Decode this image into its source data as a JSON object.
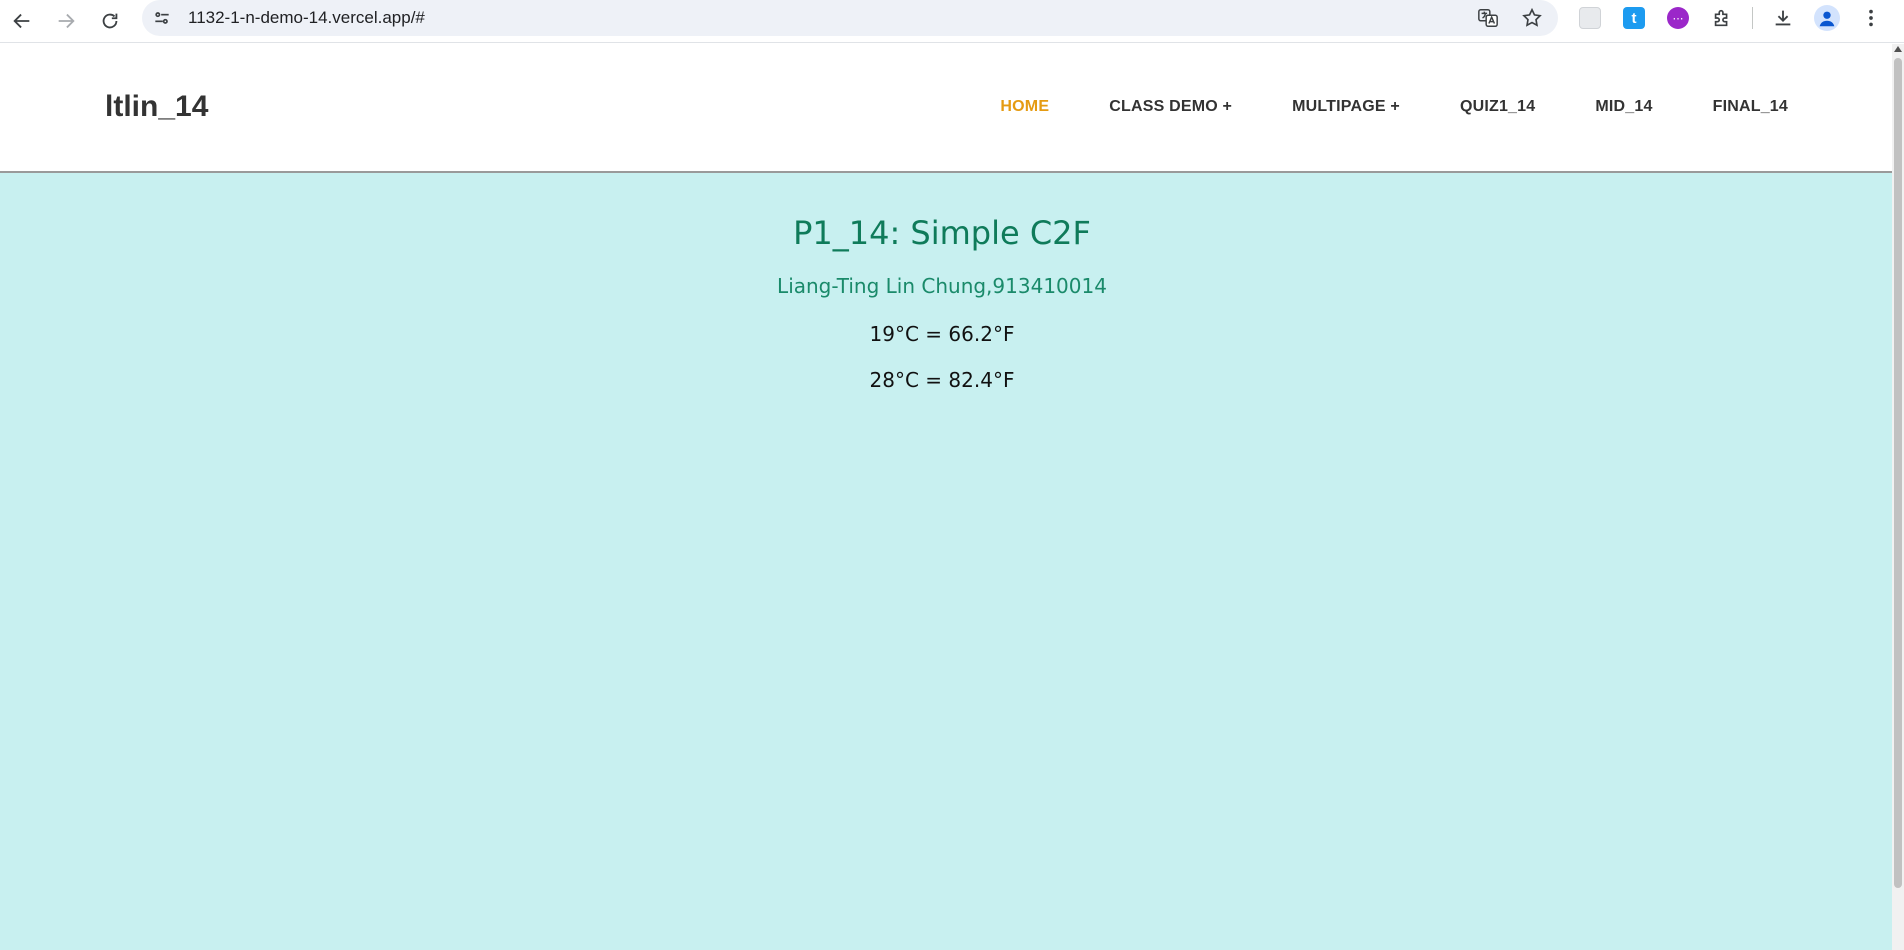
{
  "browser": {
    "url": "1132-1-n-demo-14.vercel.app/#",
    "ext_t_label": "t"
  },
  "site": {
    "brand": "ltlin_14",
    "menu": [
      {
        "label": "HOME",
        "active": true
      },
      {
        "label": "CLASS DEMO +",
        "active": false
      },
      {
        "label": "MULTIPAGE +",
        "active": false
      },
      {
        "label": "QUIZ1_14",
        "active": false
      },
      {
        "label": "MID_14",
        "active": false
      },
      {
        "label": "FINAL_14",
        "active": false
      }
    ]
  },
  "main": {
    "title": "P1_14: Simple C2F",
    "subtitle": "Liang-Ting Lin Chung,913410014",
    "conversions": [
      "19°C = 66.2°F",
      "28°C = 82.4°F"
    ]
  },
  "colors": {
    "accent_active": "#e59b12",
    "page_background": "#c8f0f0",
    "title": "#0f7b5a"
  }
}
